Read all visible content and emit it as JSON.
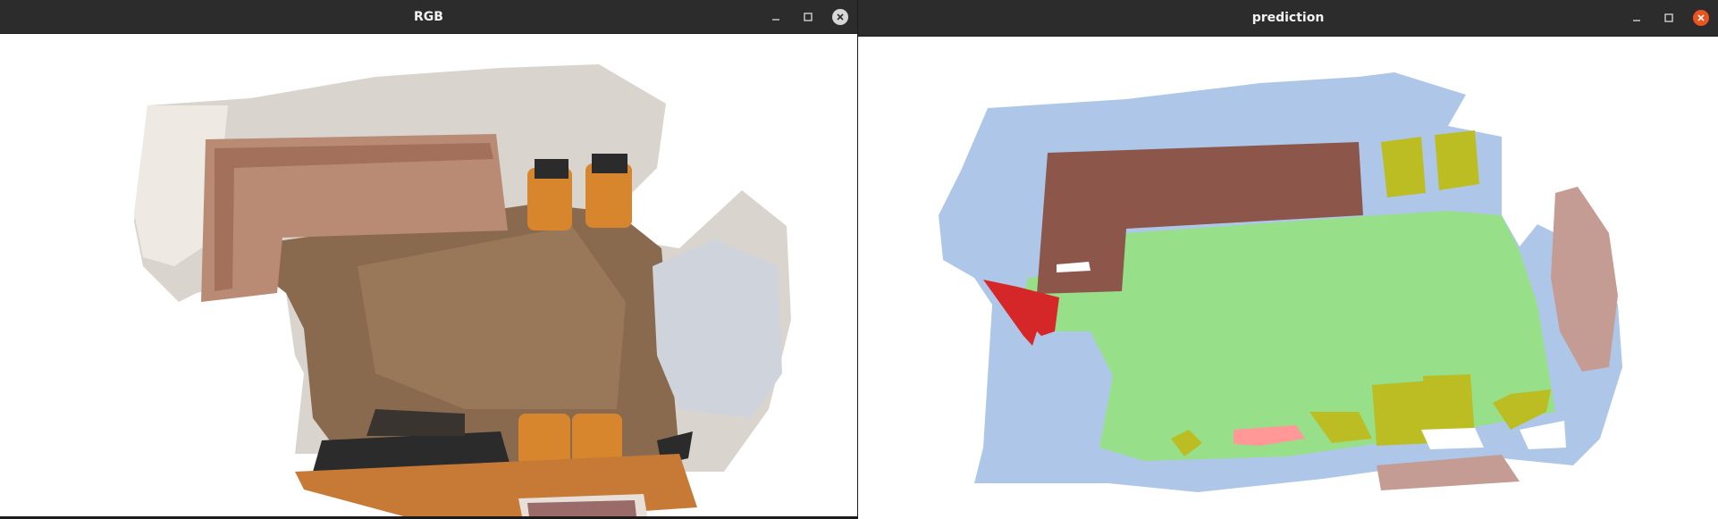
{
  "windows": [
    {
      "title": "RGB",
      "controls": [
        "minimize-icon",
        "maximize-icon",
        "close-icon"
      ]
    },
    {
      "title": "prediction",
      "controls": [
        "minimize-icon",
        "maximize-icon",
        "close-icon"
      ]
    }
  ],
  "prediction_palette": {
    "wall": "#aec7e8",
    "floor": "#98df8a",
    "sofa": "#8c564b",
    "chair": "#bcbd22",
    "table": "#c49c94",
    "cabinet": "#d62728",
    "pink_object": "#ff9896"
  },
  "rgb_palette": {
    "wall": "#d9d4cd",
    "floor": "#8a6a4f",
    "sofa": "#b98a74",
    "chair": "#d8862e",
    "table": "#c77a36",
    "dark_items": "#2b2b2b"
  }
}
